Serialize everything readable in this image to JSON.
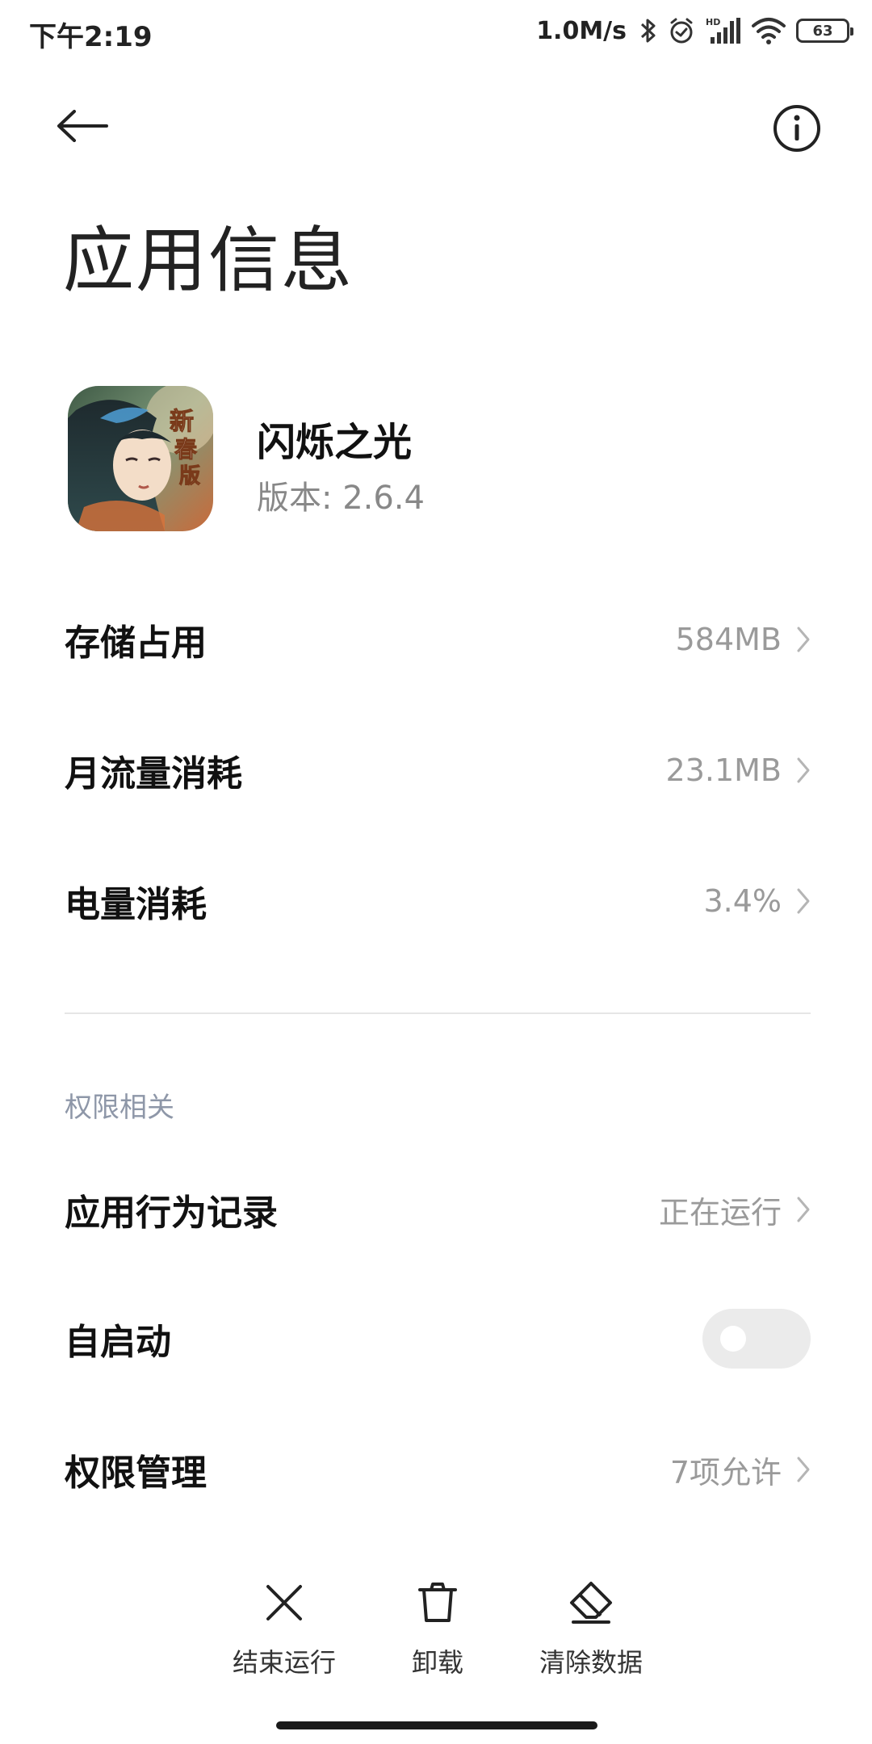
{
  "status_bar": {
    "time": "下午2:19",
    "net_speed": "1.0M/s",
    "battery": "63",
    "icons": [
      "bluetooth-icon",
      "alarm-icon",
      "hd-signal-icon",
      "wifi-icon",
      "battery-icon"
    ]
  },
  "header": {
    "title": "应用信息",
    "back_icon": "arrow-left-icon",
    "info_icon": "info-circle-icon"
  },
  "app": {
    "name": "闪烁之光",
    "version": "版本: 2.6.4"
  },
  "usage_rows": [
    {
      "label": "存储占用",
      "value": "584MB"
    },
    {
      "label": "月流量消耗",
      "value": "23.1MB"
    },
    {
      "label": "电量消耗",
      "value": "3.4%"
    }
  ],
  "permissions": {
    "section_title": "权限相关",
    "behavior_record": {
      "label": "应用行为记录",
      "value": "正在运行"
    },
    "autostart": {
      "label": "自启动",
      "enabled": false
    },
    "permission_manage": {
      "label": "权限管理",
      "value": "7项允许"
    }
  },
  "actions": [
    {
      "label": "结束运行",
      "icon": "close-icon"
    },
    {
      "label": "卸载",
      "icon": "trash-icon"
    },
    {
      "label": "清除数据",
      "icon": "eraser-icon"
    }
  ]
}
